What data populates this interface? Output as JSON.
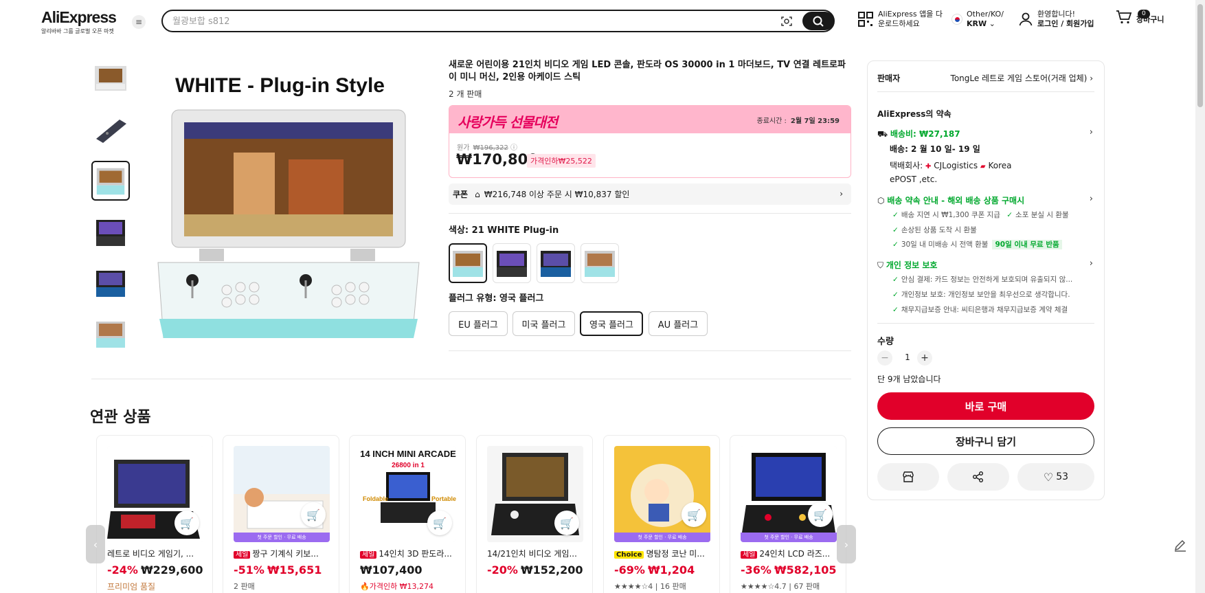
{
  "header": {
    "logo": "AliExpress",
    "logo_sub": "알리바바 그룹 글로벌 오픈 마켓",
    "search_placeholder": "월광보합 s812",
    "app_line1": "AliExpress 앱을 다",
    "app_line2": "운로드하세요",
    "region_line1": "Other/KO/",
    "region_line2": "KRW",
    "account_line1": "환영합니다!",
    "account_line2": "로그인 / 회원가입",
    "cart_count": "0",
    "cart_label": "장바구니"
  },
  "gallery": {
    "main_caption": "WHITE  -  Plug-in Style",
    "thumb_count": 6,
    "active_thumb": 2
  },
  "product": {
    "title": "새로운 어린이용 21인치 비디오 게임 LED 콘솔, 판도라 OS 30000 in 1 마더보드, TV 연결 레트로파이 미니 머신, 2인용 아케이드 스틱",
    "sold": "2 개 판매",
    "promo_banner": "사랑가득 선물대전",
    "promo_end_label": "종료시간 :",
    "promo_end_time": "2월 7일 23:59",
    "orig_label": "원가",
    "orig_price": "₩196,322",
    "price": "₩170,800",
    "price_drop": "가격인하₩25,522",
    "coupon_label": "쿠폰",
    "coupon_text": "₩216,748 이상 주문 시 ₩10,837 할인",
    "color_label": "색상: 21 WHITE Plug-in",
    "plug_label": "플러그 유형: 영국 플러그",
    "plugs": [
      "EU 플러그",
      "미국 플러그",
      "영국 플러그",
      "AU 플러그"
    ],
    "active_plug": 2
  },
  "panel": {
    "seller_label": "판매자",
    "seller_name": "TongLe 레트로 게임 스토어(거래 업체)",
    "promise_title": "AliExpress의 약속",
    "shipping_fee": "배송비: ₩27,187",
    "delivery": "배송: 2 월 10 일- 19 일",
    "carrier_label": "택배회사:",
    "carrier_1": "CJLogistics",
    "carrier_2": "Korea",
    "carrier_3": "ePOST ,etc.",
    "guarantee_title": "배송 약속 안내 - 해외 배송 상품 구매시",
    "guarantee_1": "배송 지연 시 ₩1,300 쿠폰 지급",
    "guarantee_2": "소포 분실 시 환불",
    "guarantee_3": "손상된 상품 도착 시 환불",
    "guarantee_4": "30일 내 미배송 시 전액 환불",
    "free_return": "90일 이내 무료 반품",
    "privacy_title": "개인 정보 보호",
    "privacy_1": "안심 결제: 카드 정보는 안전하게 보호되며 유출되지 않...",
    "privacy_2": "개인정보 보호: 개인정보 보안을 최우선으로 생각합니다.",
    "privacy_3": "채무지급보증 안내: 씨티은행과 채무지급보증 계약 체결",
    "qty_label": "수량",
    "qty_value": "1",
    "stock": "단 9개 남았습니다",
    "buy_now": "바로 구매",
    "add_cart": "장바구니 담기",
    "wishlist_count": "53"
  },
  "related": {
    "title": "연관 상품",
    "items": [
      {
        "badge": "",
        "name": "레트로 비디오 게임기, ...",
        "discount": "-24%",
        "price": "₩229,600",
        "sub": "프리미엄 품질",
        "strip": ""
      },
      {
        "badge": "세일",
        "name": "짱구 기계식 키보...",
        "discount": "-51%",
        "price": "₩15,651",
        "sub": "2 판매",
        "strip": "첫 주문 할인 · 무료 배송"
      },
      {
        "badge": "세일",
        "name": "14인치 3D 판도라...",
        "discount": "",
        "price": "₩107,400",
        "sub": "가격인하 ₩13,274",
        "strip": "",
        "img_title": "14 INCH MINI ARCADE",
        "img_sub": "26800 in 1",
        "img_left": "Foldable",
        "img_right": "Portable"
      },
      {
        "badge": "",
        "name": "14/21인치 비디오 게임...",
        "discount": "-20%",
        "price": "₩152,200",
        "sub": "",
        "strip": ""
      },
      {
        "badge": "Choice",
        "name": "명탐정 코난 미...",
        "discount": "-69%",
        "price": "₩1,204",
        "sub": "★★★★☆4 | 16 판매",
        "strip": "첫 주문 할인 · 무료 배송"
      },
      {
        "badge": "세일",
        "name": "24인치 LCD 라즈...",
        "discount": "-36%",
        "price": "₩582,105",
        "sub": "★★★★☆4.7 | 67 판매",
        "strip": "첫 주문 할인 · 무료 배송"
      }
    ]
  },
  "colors": {
    "accent_red": "#e1002a",
    "green": "#00a82d",
    "promo_pink": "#ffb6cc",
    "dark": "#191919"
  }
}
